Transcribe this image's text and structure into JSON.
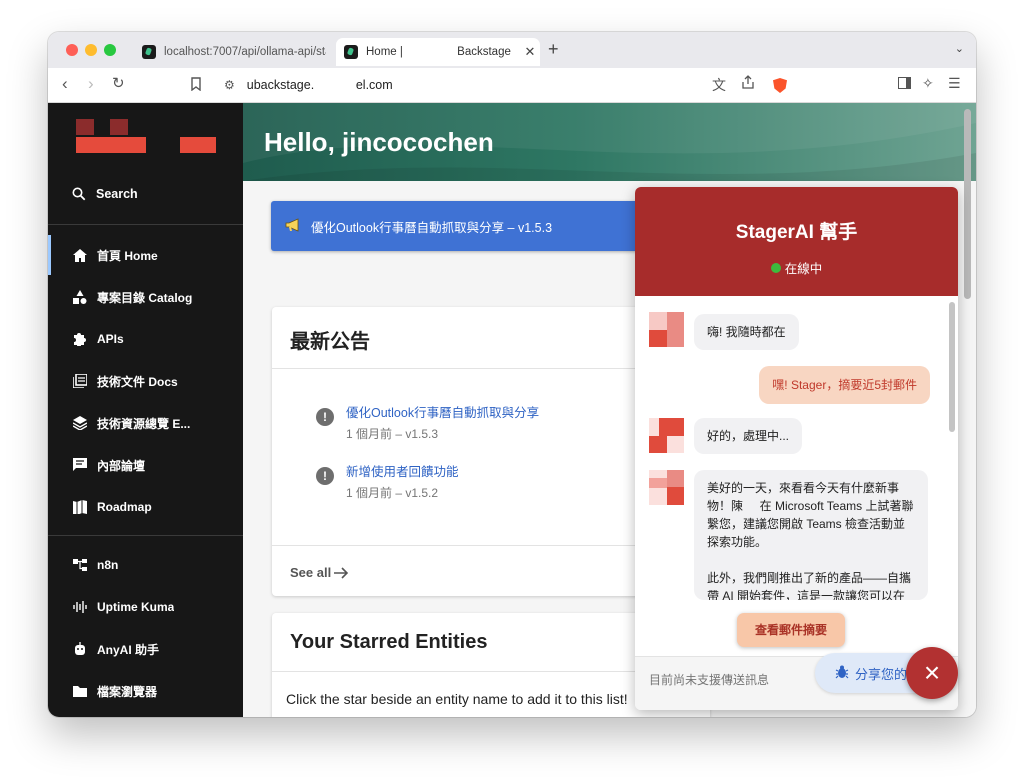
{
  "browser": {
    "tabs": [
      {
        "title": "localhost:7007/api/ollama-api/sta",
        "active": false
      },
      {
        "title": "Home |                 Backstage",
        "active": true
      }
    ],
    "new_tab_label": "+",
    "tabs_menu_label": "⌄",
    "url": "ubackstage.            el.com"
  },
  "sidebar": {
    "search_label": "Search",
    "items": [
      {
        "label": "首頁 Home",
        "icon": "home-icon",
        "active": true
      },
      {
        "label": "專案目錄 Catalog",
        "icon": "category-icon"
      },
      {
        "label": "APIs",
        "icon": "puzzle-icon"
      },
      {
        "label": "技術文件 Docs",
        "icon": "docs-icon"
      },
      {
        "label": "技術資源總覽 E...",
        "icon": "layers-icon"
      },
      {
        "label": "內部論壇",
        "icon": "forum-icon"
      },
      {
        "label": "Roadmap",
        "icon": "roadmap-icon"
      },
      {
        "label": "n8n",
        "icon": "workflow-icon"
      },
      {
        "label": "Uptime Kuma",
        "icon": "uptime-icon"
      },
      {
        "label": "AnyAI 助手",
        "icon": "robot-icon"
      },
      {
        "label": "檔案瀏覽器",
        "icon": "folder-icon"
      }
    ]
  },
  "main": {
    "greeting": "Hello, jincocochen",
    "banner_text": "優化Outlook行事曆自動抓取與分享 – v1.5.3",
    "announcements": {
      "title": "最新公告",
      "items": [
        {
          "title": "優化Outlook行事曆自動抓取與分享",
          "meta": "1 個月前 – v1.5.3"
        },
        {
          "title": "新增使用者回饋功能",
          "meta": "1 個月前 – v1.5.2"
        }
      ],
      "see_all": "See all"
    },
    "starred": {
      "title": "Your Starred Entities",
      "empty_text": "Click the star beside an entity name to add it to this list!"
    }
  },
  "chat": {
    "title": "StagerAI 幫手",
    "status": "在線中",
    "status_color": "#3dbb3d",
    "messages": [
      {
        "from": "bot",
        "text": "嗨! 我隨時都在"
      },
      {
        "from": "user",
        "text": "嘿! Stager，摘要近5封郵件"
      },
      {
        "from": "bot",
        "text": "好的，處理中..."
      },
      {
        "from": "bot",
        "paragraphs": [
          "美好的一天，來看看今天有什麼新事物！陳     在 Microsoft Teams 上試著聯繫您，建議您開啟 Teams 檢查活動並探索功能。",
          "此外，我們剛推出了新的產品——自攜帶 AI 開始套件，這是一款讓您可以在"
        ]
      }
    ],
    "summary_button": "查看郵件摘要",
    "input_placeholder": "目前尚未支援傳送訊息"
  },
  "feedback_label": "分享您的",
  "close_label": "×",
  "colors": {
    "brand_red": "#a72c2b",
    "sidebar_bg": "#171717",
    "banner_blue": "#3f72d4",
    "link_blue": "#2f63c4",
    "hero_green": "#2e7763"
  }
}
